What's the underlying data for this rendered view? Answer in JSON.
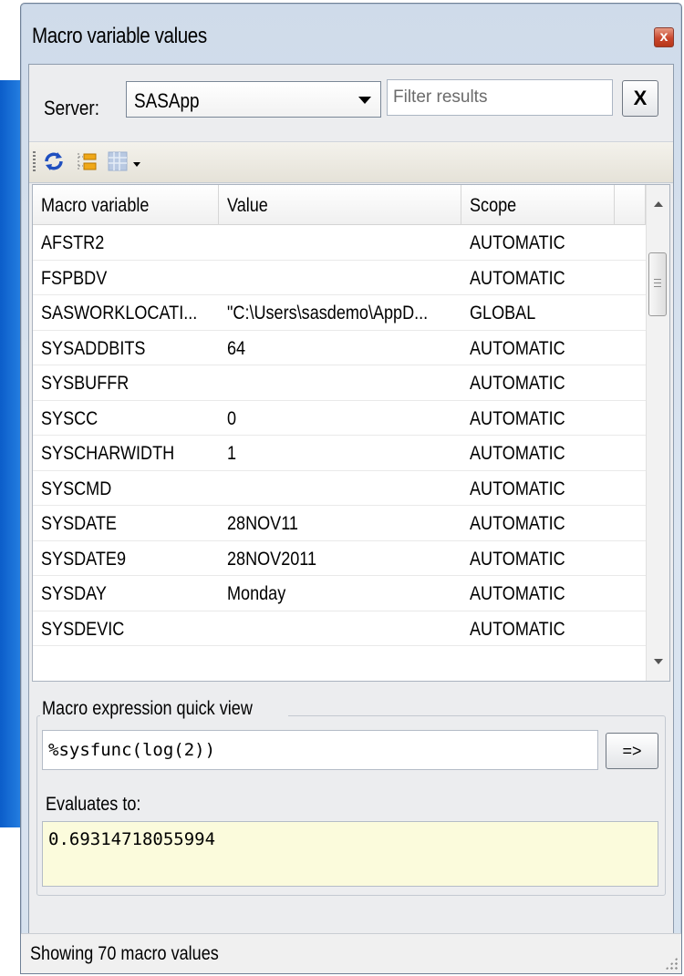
{
  "window": {
    "title": "Macro variable values",
    "close_label": "x"
  },
  "server": {
    "label": "Server:",
    "selected": "SASApp"
  },
  "filter": {
    "placeholder": "Filter results",
    "value": ""
  },
  "clear_button_label": "X",
  "toolbar": {
    "icons": [
      "refresh-icon",
      "sort-icon",
      "grid-view-icon"
    ]
  },
  "table": {
    "columns": [
      "Macro variable",
      "Value",
      "Scope"
    ],
    "rows": [
      {
        "name": "AFSTR2",
        "value": "",
        "scope": "AUTOMATIC"
      },
      {
        "name": "FSPBDV",
        "value": "",
        "scope": "AUTOMATIC"
      },
      {
        "name": "SASWORKLOCATI...",
        "value": "\"C:\\Users\\sasdemo\\AppD...",
        "scope": "GLOBAL"
      },
      {
        "name": "SYSADDBITS",
        "value": "64",
        "scope": "AUTOMATIC"
      },
      {
        "name": "SYSBUFFR",
        "value": "",
        "scope": "AUTOMATIC"
      },
      {
        "name": "SYSCC",
        "value": "0",
        "scope": "AUTOMATIC"
      },
      {
        "name": "SYSCHARWIDTH",
        "value": "1",
        "scope": "AUTOMATIC"
      },
      {
        "name": "SYSCMD",
        "value": "",
        "scope": "AUTOMATIC"
      },
      {
        "name": "SYSDATE",
        "value": "28NOV11",
        "scope": "AUTOMATIC"
      },
      {
        "name": "SYSDATE9",
        "value": "28NOV2011",
        "scope": "AUTOMATIC"
      },
      {
        "name": "SYSDAY",
        "value": "Monday",
        "scope": "AUTOMATIC"
      },
      {
        "name": "SYSDEVIC",
        "value": "",
        "scope": "AUTOMATIC"
      }
    ]
  },
  "quick_view": {
    "legend": "Macro expression quick view",
    "expression": "%sysfunc(log(2))",
    "evaluate_button": "=>",
    "evaluates_label": "Evaluates to:",
    "result": "0.69314718055994"
  },
  "status": {
    "text": "Showing 70 macro values"
  },
  "colors": {
    "result_background": "#fbfbdc",
    "desktop_blue": "#1a6fd8"
  }
}
